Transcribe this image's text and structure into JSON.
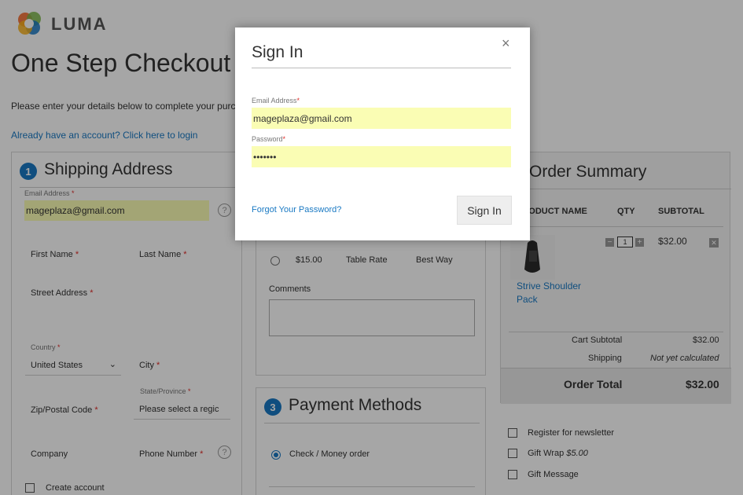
{
  "brand": {
    "logo_text": "LUMA"
  },
  "page": {
    "title": "One Step Checkout",
    "intro": "Please enter your details below to complete your purchase.",
    "login_link": "Already have an account? Click here to login"
  },
  "shipping": {
    "step": "1",
    "title": "Shipping Address",
    "email_label": "Email Address",
    "email_value": "mageplaza@gmail.com",
    "first_name_label": "First Name",
    "last_name_label": "Last Name",
    "street_label": "Street Address",
    "country_label": "Country",
    "country_value": "United States",
    "city_label": "City",
    "state_label": "State/Province",
    "state_value": "Please select a regic",
    "zip_label": "Zip/Postal Code",
    "company_label": "Company",
    "phone_label": "Phone Number",
    "create_account_label": "Create account",
    "required_mark": "*",
    "help_glyph": "?"
  },
  "shipping_method": {
    "price": "$15.00",
    "rate": "Table Rate",
    "carrier": "Best Way",
    "comments_label": "Comments"
  },
  "payment": {
    "step": "3",
    "title": "Payment Methods",
    "option": "Check / Money order"
  },
  "summary": {
    "title": "Order Summary",
    "col_product": "PRODUCT NAME",
    "col_qty": "QTY",
    "col_subtotal": "SUBTOTAL",
    "product_name_line1": "Strive Shoulder",
    "product_name_line2": "Pack",
    "qty": "1",
    "item_subtotal": "$32.00",
    "cart_subtotal_label": "Cart Subtotal",
    "cart_subtotal_value": "$32.00",
    "shipping_label": "Shipping",
    "shipping_value": "Not yet calculated",
    "order_total_label": "Order Total",
    "order_total_value": "$32.00"
  },
  "extras": {
    "newsletter": "Register for newsletter",
    "gift_wrap": "Gift Wrap",
    "gift_wrap_price": "$5.00",
    "gift_message": "Gift Message"
  },
  "modal": {
    "title": "Sign In",
    "close_glyph": "×",
    "email_label": "Email Address",
    "email_value": "mageplaza@gmail.com",
    "password_label": "Password",
    "password_value": "•••••••",
    "forgot_link": "Forgot Your Password?",
    "signin_button": "Sign In"
  }
}
